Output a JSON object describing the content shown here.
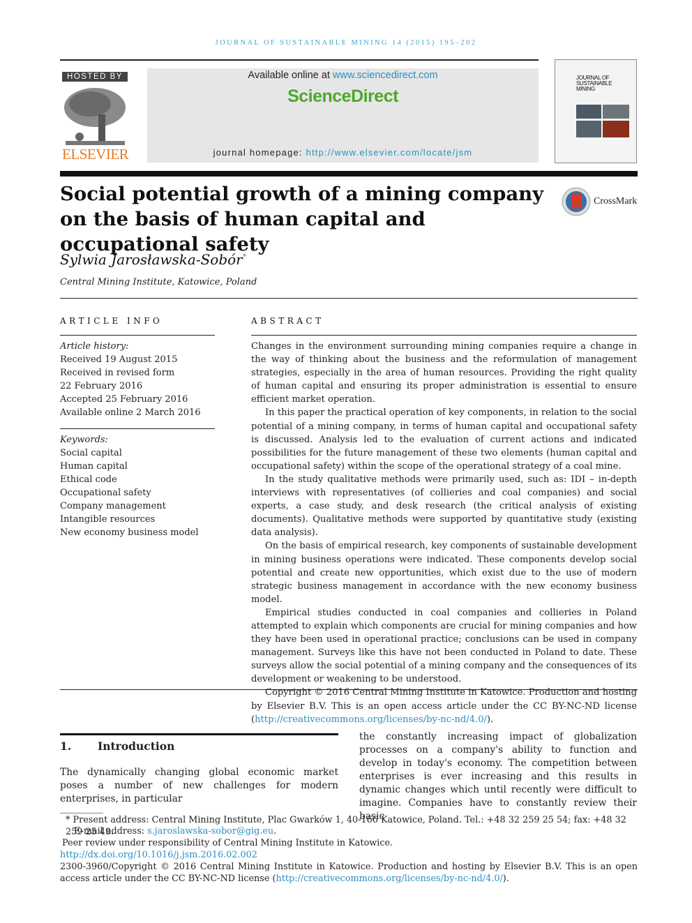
{
  "running_header": "JOURNAL OF SUSTAINABLE MINING 14 (2015) 195–202",
  "hosted_by": "HOSTED BY",
  "publisher_logo": "ELSEVIER",
  "available_online": "Available online at ",
  "sciencedirect_url": "www.sciencedirect.com",
  "sciencedirect_logo": "ScienceDirect",
  "homepage_label": "journal homepage: ",
  "homepage_url": "http://www.elsevier.com/locate/jsm",
  "cover_title": "JOURNAL OF SUSTAINABLE MINING",
  "title": "Social potential growth of a mining company on the basis of human capital and occupational safety",
  "crossmark": "CrossMark",
  "author": "Sylwia Jarosławska-Sobór",
  "author_mark": "*",
  "affiliation": "Central Mining Institute, Katowice, Poland",
  "article_info": {
    "heading": "ARTICLE INFO",
    "history_label": "Article history:",
    "history": [
      "Received 19 August 2015",
      "Received in revised form",
      "22 February 2016",
      "Accepted 25 February 2016",
      "Available online 2 March 2016"
    ],
    "keywords_label": "Keywords:",
    "keywords": [
      "Social capital",
      "Human capital",
      "Ethical code",
      "Occupational safety",
      "Company management",
      "Intangible resources",
      "New economy business model"
    ]
  },
  "abstract": {
    "heading": "ABSTRACT",
    "paragraphs": [
      "Changes in the environment surrounding mining companies require a change in the way of thinking about the business and the reformulation of management strategies, especially in the area of human resources. Providing the right quality of human capital and ensuring its proper administration is essential to ensure efficient market operation.",
      "In this paper the practical operation of key components, in relation to the social potential of a mining company, in terms of human capital and occupational safety is discussed. Analysis led to the evaluation of current actions and indicated possibilities for the future management of these two elements (human capital and occupational safety) within the scope of the operational strategy of a coal mine.",
      "In the study qualitative methods were primarily used, such as: IDI – in-depth interviews with representatives (of collieries and coal companies) and social experts, a case study, and desk research (the critical analysis of existing documents). Qualitative methods were supported by quantitative study (existing data analysis).",
      "On the basis of empirical research, key components of sustainable development in mining business operations were indicated. These components develop social potential and create new opportunities, which exist due to the use of modern strategic business management in accordance with the new economy business model.",
      "Empirical studies conducted in coal companies and collieries in Poland attempted to explain which components are crucial for mining companies and how they have been used in operational practice; conclusions can be used in company management. Surveys like this have not been conducted in Poland to date. These surveys allow the social potential of a mining company and the consequences of its development or weakening to be understood."
    ],
    "copyright": "Copyright © 2016 Central Mining Institute in Katowice. Production and hosting by Elsevier B.V. This is an open access article under the CC BY-NC-ND license (",
    "license_url": "http://creativecommons.org/licenses/by-nc-nd/4.0/",
    "copyright_end": ")."
  },
  "intro": {
    "number": "1.",
    "heading": "Introduction",
    "left": "The dynamically changing global economic market poses a number of new challenges for modern enterprises, in particular",
    "right": "the constantly increasing impact of globalization processes on a company's ability to function and develop in today's economy. The competition between enterprises is ever increasing and this results in dynamic changes which until recently were difficult to imagine. Companies have to constantly review their basic"
  },
  "footnotes": {
    "present_address": "* Present address: Central Mining Institute, Plac Gwarków 1, 40-166 Katowice, Poland. Tel.: +48 32 259 25 54; fax: +48 32 259 25 49.",
    "email_label": "E-mail address: ",
    "email": "s.jaroslawska-sobor@gig.eu",
    "email_end": ".",
    "peer_review": "Peer review under responsibility of Central Mining Institute in Katowice.",
    "doi": "http://dx.doi.org/10.1016/j.jsm.2016.02.002",
    "copyright": "2300-3960/Copyright © 2016 Central Mining Institute in Katowice. Production and hosting by Elsevier B.V. This is an open access article under the CC BY-NC-ND license (",
    "license_url": "http://creativecommons.org/licenses/by-nc-nd/4.0/",
    "copyright_end": ")."
  },
  "colors": {
    "link": "#2a8fc1",
    "sciencedirect": "#4ea72c",
    "elsevier": "#e87a1d"
  }
}
